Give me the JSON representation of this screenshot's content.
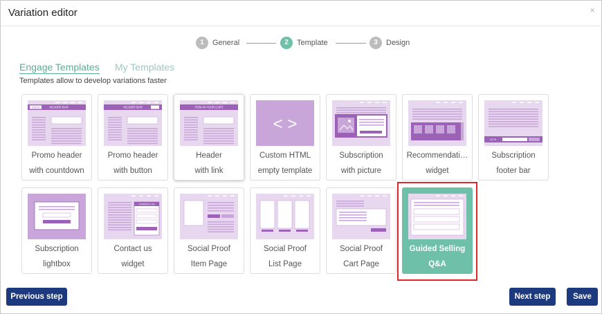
{
  "dialog": {
    "title": "Variation editor",
    "close_glyph": "×"
  },
  "steps": [
    {
      "number": "1",
      "label": "General",
      "state": "done"
    },
    {
      "number": "2",
      "label": "Template",
      "state": "active"
    },
    {
      "number": "3",
      "label": "Design",
      "state": "pending"
    }
  ],
  "tabs": {
    "engage": "Engage Templates",
    "my": "My Templates"
  },
  "description": "Templates allow to develop variations faster",
  "colors": {
    "accent": "#6fc0a8",
    "thumb_light": "#e8d8ef",
    "thumb_dark": "#9b62b8",
    "thumb_mid": "#c9a6d9",
    "button": "#1d3a7f",
    "highlight": "#e0252b"
  },
  "cards": [
    {
      "line1": "Promo header",
      "line2": "with countdown",
      "thumb": "promo-countdown",
      "header_text": "HEADER BAR",
      "badge_text": "0:00:00"
    },
    {
      "line1": "Promo header",
      "line2": "with button",
      "thumb": "promo-button",
      "header_text": "HEADER BAR"
    },
    {
      "line1": "Header",
      "line2": "with link",
      "thumb": "header-link",
      "header_text": "ITEM IN YOUR CART"
    },
    {
      "line1": "Custom HTML",
      "line2": "empty template",
      "thumb": "custom-html",
      "code_glyph": "< >"
    },
    {
      "line1": "Subscription",
      "line2": "with picture",
      "thumb": "subscription-picture"
    },
    {
      "line1": "Recommendati…",
      "line2": "widget",
      "thumb": "recommendation"
    },
    {
      "line1": "Subscription",
      "line2": "footer bar",
      "thumb": "footer-bar",
      "badge_text": "10 %"
    },
    {
      "line1": "Subscription",
      "line2": "lightbox",
      "thumb": "lightbox"
    },
    {
      "line1": "Contact us",
      "line2": "widget",
      "thumb": "contact",
      "header_text": "CONTACT US"
    },
    {
      "line1": "Social Proof",
      "line2": "Item Page",
      "thumb": "sp-item"
    },
    {
      "line1": "Social Proof",
      "line2": "List Page",
      "thumb": "sp-list"
    },
    {
      "line1": "Social Proof",
      "line2": "Cart Page",
      "thumb": "sp-cart"
    },
    {
      "line1": "Guided Selling",
      "line2": "Q&A",
      "thumb": "guided",
      "selected": true
    }
  ],
  "buttons": {
    "prev": "Previous step",
    "next": "Next step",
    "save": "Save"
  }
}
